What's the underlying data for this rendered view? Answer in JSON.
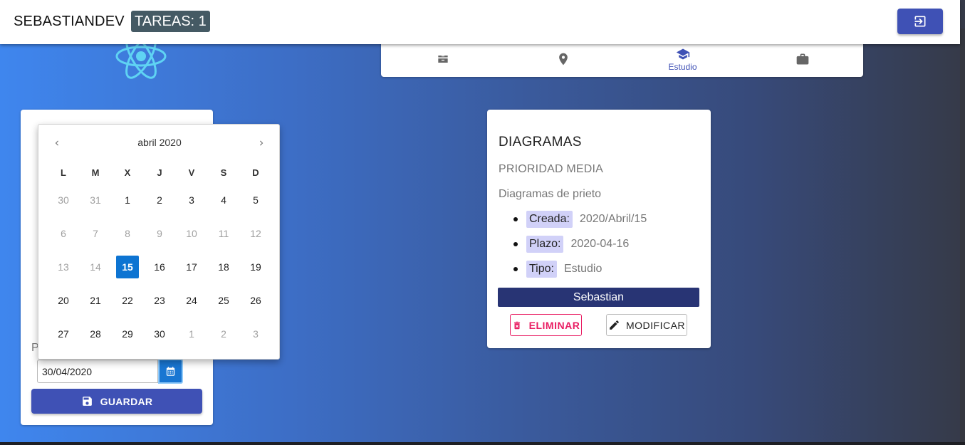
{
  "header": {
    "username": "SEBASTIANDEV",
    "task_count": "TAREAS: 1",
    "logout_icon": "logout-icon"
  },
  "categories": [
    {
      "icon": "inbox-icon",
      "label": ""
    },
    {
      "icon": "location-pin-icon",
      "label": ""
    },
    {
      "icon": "graduation-cap-icon",
      "label": "Estudio"
    },
    {
      "icon": "briefcase-icon",
      "label": ""
    }
  ],
  "form": {
    "date_value": "30/04/2020",
    "date_placeholder": "",
    "partial_label": "P",
    "save_label": "GUARDAR"
  },
  "datepicker": {
    "month": "abril 2020",
    "weekdays": [
      "L",
      "M",
      "X",
      "J",
      "V",
      "S",
      "D"
    ],
    "weeks": [
      [
        "30",
        "31",
        "1",
        "2",
        "3",
        "4",
        "5"
      ],
      [
        "6",
        "7",
        "8",
        "9",
        "10",
        "11",
        "12"
      ],
      [
        "13",
        "14",
        "15",
        "16",
        "17",
        "18",
        "19"
      ],
      [
        "20",
        "21",
        "22",
        "23",
        "24",
        "25",
        "26"
      ],
      [
        "27",
        "28",
        "29",
        "30",
        "1",
        "2",
        "3"
      ]
    ],
    "selected": "15"
  },
  "task": {
    "title": "DIAGRAMAS",
    "priority": "PRIORIDAD MEDIA",
    "description": "Diagramas de prieto",
    "created_label": "Creada:",
    "created_value": "2020/Abril/15",
    "deadline_label": "Plazo:",
    "deadline_value": "2020-04-16",
    "type_label": "Tipo:",
    "type_value": "Estudio",
    "owner": "Sebastian",
    "delete_label": "ELIMINAR",
    "modify_label": "MODIFICAR"
  },
  "colors": {
    "primary": "#3f51b5",
    "accent_pink": "#e91e63",
    "calendar_selected": "#0d74d2",
    "owner_bar": "#283474",
    "badge": "#455a64"
  }
}
